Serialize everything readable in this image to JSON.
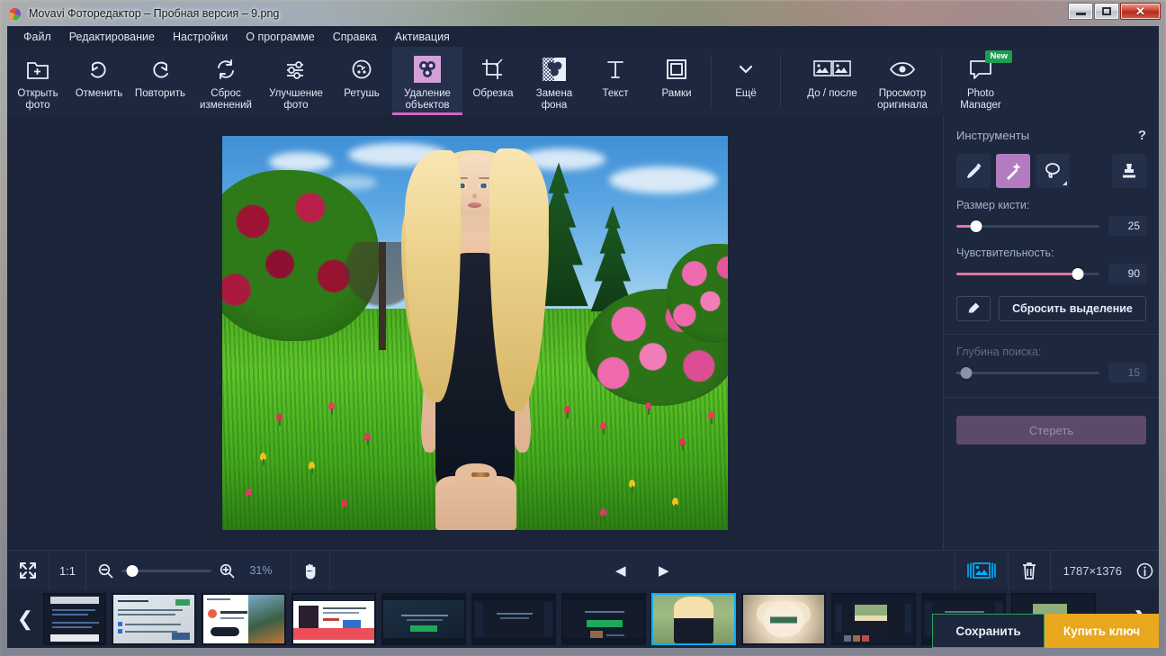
{
  "window": {
    "title": "Movavi Фоторедактор – Пробная версия – 9.png",
    "minimize_label": "—",
    "maximize_label": "□",
    "close_label": "✕"
  },
  "menubar": {
    "items": [
      {
        "label": "Файл"
      },
      {
        "label": "Редактирование"
      },
      {
        "label": "Настройки"
      },
      {
        "label": "О программе"
      },
      {
        "label": "Справка"
      },
      {
        "label": "Активация"
      }
    ]
  },
  "toolbar": {
    "items": [
      {
        "label": "Открыть\nфото",
        "line1": "Открыть",
        "line2": "фото",
        "icon": "open-photo-icon"
      },
      {
        "label": "Отменить",
        "line1": "Отменить",
        "line2": "",
        "icon": "undo-icon"
      },
      {
        "label": "Повторить",
        "line1": "Повторить",
        "line2": "",
        "icon": "redo-icon"
      },
      {
        "label": "Сброс изменений",
        "line1": "Сброс",
        "line2": "изменений",
        "icon": "reset-icon"
      },
      {
        "label": "Улучшение фото",
        "line1": "Улучшение",
        "line2": "фото",
        "icon": "adjust-icon"
      },
      {
        "label": "Ретушь",
        "line1": "Ретушь",
        "line2": "",
        "icon": "retouch-icon"
      },
      {
        "label": "Удаление объектов",
        "line1": "Удаление",
        "line2": "объектов",
        "icon": "object-removal-icon",
        "active": true
      },
      {
        "label": "Обрезка",
        "line1": "Обрезка",
        "line2": "",
        "icon": "crop-icon"
      },
      {
        "label": "Замена фона",
        "line1": "Замена",
        "line2": "фона",
        "icon": "background-change-icon"
      },
      {
        "label": "Текст",
        "line1": "Текст",
        "line2": "",
        "icon": "text-icon"
      },
      {
        "label": "Рамки",
        "line1": "Рамки",
        "line2": "",
        "icon": "frames-icon"
      },
      {
        "label": "Ещё",
        "line1": "Ещё",
        "line2": "",
        "icon": "chevron-down-icon"
      }
    ],
    "right_items": [
      {
        "label": "До / после",
        "line1": "До / после",
        "line2": "",
        "icon": "before-after-icon"
      },
      {
        "label": "Просмотр оригинала",
        "line1": "Просмотр",
        "line2": "оригинала",
        "icon": "eye-icon"
      },
      {
        "label": "Photo Manager",
        "line1": "Photo",
        "line2": "Manager",
        "icon": "photo-manager-icon",
        "badge": "New"
      }
    ]
  },
  "panel": {
    "title": "Инструменты",
    "help": "?",
    "tools": [
      {
        "name": "brush",
        "selected": false
      },
      {
        "name": "magic-wand",
        "selected": true
      },
      {
        "name": "lasso",
        "selected": false,
        "has_dropdown": true
      },
      {
        "name": "stamp",
        "selected": false
      }
    ],
    "brush_size": {
      "label": "Размер кисти:",
      "value": "25",
      "percent": 14
    },
    "sensitivity": {
      "label": "Чувствительность:",
      "value": "90",
      "percent": 85
    },
    "eraser_button": "eraser-icon",
    "reset_selection": "Сбросить выделение",
    "search_depth": {
      "label": "Глубина поиска:",
      "value": "15",
      "percent": 7,
      "disabled": true
    },
    "erase_button": {
      "label": "Стереть",
      "disabled": true
    }
  },
  "bottombar": {
    "fit_label": "fit-screen-icon",
    "actual_size_label": "1:1",
    "zoom_out": "zoom-out-icon",
    "zoom_in": "zoom-in-icon",
    "zoom_percent": "31%",
    "zoom_slider_percent": 12,
    "hand_tool": "hand-icon",
    "prev_label": "◀",
    "next_label": "▶",
    "filmstrip_toggle": "filmstrip-icon",
    "delete_label": "trash-icon",
    "dimensions": "1787×1376",
    "info_label": "i"
  },
  "filmstrip": {
    "prev_arrow": "❮",
    "next_arrow": "❯",
    "thumbs": [
      {
        "kind": "web-dark",
        "selected": false
      },
      {
        "kind": "web-light",
        "selected": false
      },
      {
        "kind": "web-hero",
        "selected": false
      },
      {
        "kind": "web-product",
        "selected": false
      },
      {
        "kind": "app-dark",
        "selected": false
      },
      {
        "kind": "app-dark2",
        "selected": false
      },
      {
        "kind": "app-green",
        "selected": false
      },
      {
        "kind": "girl",
        "selected": true
      },
      {
        "kind": "cat",
        "selected": false
      },
      {
        "kind": "editor-girl",
        "selected": false
      },
      {
        "kind": "app-green2",
        "selected": false
      },
      {
        "kind": "editor-girl2",
        "selected": false
      }
    ]
  },
  "scrollbar": {
    "left_arrow": "◀",
    "right_arrow": "▶"
  },
  "actions": {
    "save": "Сохранить",
    "buy_key": "Купить ключ"
  },
  "colors": {
    "panel_bg": "#1d273d",
    "app_bg": "#1b2438",
    "accent_pink": "#d566c4",
    "accent_purple": "#b37cc0",
    "slider_pink": "#e0799e",
    "buy_orange": "#e8a71c",
    "save_green": "#2e9e5f",
    "selection_cyan": "#00b0ff",
    "badge_green": "#1e9e52"
  }
}
